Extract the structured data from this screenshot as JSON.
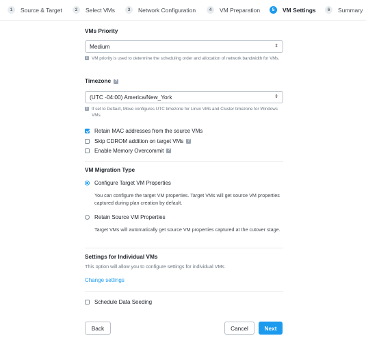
{
  "stepper": {
    "steps": [
      {
        "num": "1",
        "label": "Source & Target"
      },
      {
        "num": "2",
        "label": "Select VMs"
      },
      {
        "num": "3",
        "label": "Network Configuration"
      },
      {
        "num": "4",
        "label": "VM Preparation"
      },
      {
        "num": "5",
        "label": "VM Settings"
      },
      {
        "num": "6",
        "label": "Summary"
      }
    ],
    "active": "VM Settings"
  },
  "vm_priority": {
    "title": "VMs Priority",
    "value": "Medium",
    "hint": "VM priority is used to determine the scheduling order and allocation of network bandwidth for VMs."
  },
  "timezone": {
    "title": "Timezone",
    "value": "(UTC -04:00) America/New_York",
    "hint": "If set to Default, Move configures UTC timezone for Linux VMs and Cluster timezone for Windows VMs."
  },
  "options": {
    "retain_mac": {
      "label": "Retain MAC addresses from the source VMs",
      "checked": true
    },
    "skip_cdrom": {
      "label": "Skip CDROM addition on target VMs",
      "checked": false
    },
    "memory_overcommit": {
      "label": "Enable Memory Overcommit",
      "checked": false
    }
  },
  "migration_type": {
    "title": "VM Migration Type",
    "configure_target": {
      "label": "Configure Target VM Properties",
      "selected": true,
      "desc": "You can configure the target VM properties. Target VMs will get source VM properties captured during plan creation by default."
    },
    "retain_source": {
      "label": "Retain Source VM Properties",
      "selected": false,
      "desc": "Target VMs will automatically get source VM properties captured at the cutover stage."
    }
  },
  "individual": {
    "title": "Settings for Individual VMs",
    "desc": "This option will allow you to configure settings for individual VMs",
    "link": "Change settings"
  },
  "seeding": {
    "label": "Schedule Data Seeding",
    "checked": false
  },
  "footer": {
    "back": "Back",
    "cancel": "Cancel",
    "next": "Next"
  },
  "colors": {
    "accent": "#1b9aee",
    "text": "#22272e",
    "muted": "#6a747e"
  },
  "icons": {
    "help": "help-icon",
    "info": "info-icon",
    "caret": "select-caret-icon"
  }
}
